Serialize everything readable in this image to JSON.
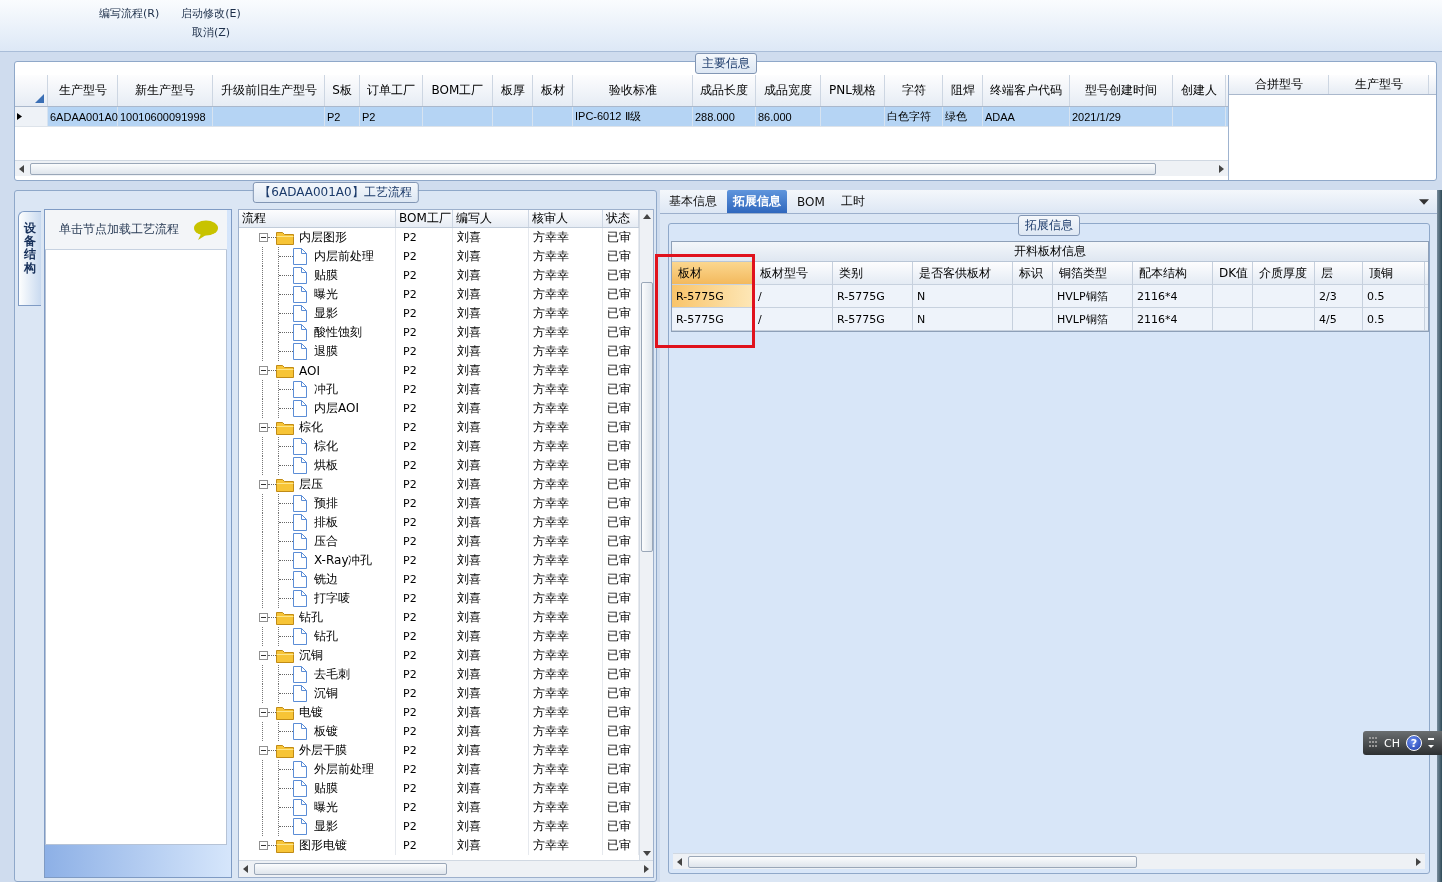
{
  "toolbar": {
    "items": [
      {
        "lines": [
          "编写流程(R)"
        ]
      },
      {
        "lines": [
          "启动修改(E)",
          "取消(Z)"
        ]
      }
    ]
  },
  "main_info": {
    "title": "主要信息",
    "table": {
      "columns": [
        "生产型号",
        "新生产型号",
        "升级前旧生产型号",
        "S板",
        "订单工厂",
        "BOM工厂",
        "板厚",
        "板材",
        "验收标准",
        "成品长度",
        "成品宽度",
        "PNL规格",
        "字符",
        "阻焊",
        "终端客户代码",
        "型号创建时间",
        "创建人"
      ],
      "rows": [
        {
          "selected": true,
          "cells": [
            "6ADAA001A0",
            "10010600091998",
            "",
            "P2",
            "P2",
            "",
            "",
            "",
            "IPC-6012 Ⅱ级",
            "288.000",
            "86.000",
            "",
            "白色字符",
            "绿色",
            "ADAA",
            "2021/1/29",
            ""
          ]
        }
      ]
    },
    "side_table": {
      "columns": [
        "合拼型号",
        "生产型号"
      ]
    }
  },
  "process": {
    "title": "【6ADAA001A0】工艺流程",
    "side_tab": "设备结构",
    "node_hint": "单击节点加载工艺流程",
    "tree": {
      "columns": [
        "流程",
        "BOM工厂",
        "编写人",
        "核审人",
        "状态"
      ],
      "rows": [
        {
          "name": "内层图形",
          "bom": "P2",
          "writer": "刘喜",
          "reviewer": "方幸幸",
          "status": "已审",
          "expanded": true,
          "children": [
            {
              "name": "内层前处理",
              "bom": "P2",
              "writer": "刘喜",
              "reviewer": "方幸幸",
              "status": "已审"
            },
            {
              "name": "贴膜",
              "bom": "P2",
              "writer": "刘喜",
              "reviewer": "方幸幸",
              "status": "已审"
            },
            {
              "name": "曝光",
              "bom": "P2",
              "writer": "刘喜",
              "reviewer": "方幸幸",
              "status": "已审"
            },
            {
              "name": "显影",
              "bom": "P2",
              "writer": "刘喜",
              "reviewer": "方幸幸",
              "status": "已审"
            },
            {
              "name": "酸性蚀刻",
              "bom": "P2",
              "writer": "刘喜",
              "reviewer": "方幸幸",
              "status": "已审"
            },
            {
              "name": "退膜",
              "bom": "P2",
              "writer": "刘喜",
              "reviewer": "方幸幸",
              "status": "已审"
            }
          ]
        },
        {
          "name": "AOI",
          "bom": "P2",
          "writer": "刘喜",
          "reviewer": "方幸幸",
          "status": "已审",
          "expanded": true,
          "children": [
            {
              "name": "冲孔",
              "bom": "P2",
              "writer": "刘喜",
              "reviewer": "方幸幸",
              "status": "已审"
            },
            {
              "name": "内层AOI",
              "bom": "P2",
              "writer": "刘喜",
              "reviewer": "方幸幸",
              "status": "已审"
            }
          ]
        },
        {
          "name": "棕化",
          "bom": "P2",
          "writer": "刘喜",
          "reviewer": "方幸幸",
          "status": "已审",
          "expanded": true,
          "children": [
            {
              "name": "棕化",
              "bom": "P2",
              "writer": "刘喜",
              "reviewer": "方幸幸",
              "status": "已审"
            },
            {
              "name": "烘板",
              "bom": "P2",
              "writer": "刘喜",
              "reviewer": "方幸幸",
              "status": "已审"
            }
          ]
        },
        {
          "name": "层压",
          "bom": "P2",
          "writer": "刘喜",
          "reviewer": "方幸幸",
          "status": "已审",
          "expanded": true,
          "children": [
            {
              "name": "预排",
              "bom": "P2",
              "writer": "刘喜",
              "reviewer": "方幸幸",
              "status": "已审"
            },
            {
              "name": "排板",
              "bom": "P2",
              "writer": "刘喜",
              "reviewer": "方幸幸",
              "status": "已审"
            },
            {
              "name": "压合",
              "bom": "P2",
              "writer": "刘喜",
              "reviewer": "方幸幸",
              "status": "已审"
            },
            {
              "name": "X-Ray冲孔",
              "bom": "P2",
              "writer": "刘喜",
              "reviewer": "方幸幸",
              "status": "已审"
            },
            {
              "name": "铣边",
              "bom": "P2",
              "writer": "刘喜",
              "reviewer": "方幸幸",
              "status": "已审"
            },
            {
              "name": "打字唛",
              "bom": "P2",
              "writer": "刘喜",
              "reviewer": "方幸幸",
              "status": "已审"
            }
          ]
        },
        {
          "name": "钻孔",
          "bom": "P2",
          "writer": "刘喜",
          "reviewer": "方幸幸",
          "status": "已审",
          "expanded": true,
          "children": [
            {
              "name": "钻孔",
              "bom": "P2",
              "writer": "刘喜",
              "reviewer": "方幸幸",
              "status": "已审"
            }
          ]
        },
        {
          "name": "沉铜",
          "bom": "P2",
          "writer": "刘喜",
          "reviewer": "方幸幸",
          "status": "已审",
          "expanded": true,
          "children": [
            {
              "name": "去毛刺",
              "bom": "P2",
              "writer": "刘喜",
              "reviewer": "方幸幸",
              "status": "已审"
            },
            {
              "name": "沉铜",
              "bom": "P2",
              "writer": "刘喜",
              "reviewer": "方幸幸",
              "status": "已审"
            }
          ]
        },
        {
          "name": "电镀",
          "bom": "P2",
          "writer": "刘喜",
          "reviewer": "方幸幸",
          "status": "已审",
          "expanded": true,
          "children": [
            {
              "name": "板镀",
              "bom": "P2",
              "writer": "刘喜",
              "reviewer": "方幸幸",
              "status": "已审"
            }
          ]
        },
        {
          "name": "外层干膜",
          "bom": "P2",
          "writer": "刘喜",
          "reviewer": "方幸幸",
          "status": "已审",
          "expanded": true,
          "children": [
            {
              "name": "外层前处理",
              "bom": "P2",
              "writer": "刘喜",
              "reviewer": "方幸幸",
              "status": "已审"
            },
            {
              "name": "贴膜",
              "bom": "P2",
              "writer": "刘喜",
              "reviewer": "方幸幸",
              "status": "已审"
            },
            {
              "name": "曝光",
              "bom": "P2",
              "writer": "刘喜",
              "reviewer": "方幸幸",
              "status": "已审"
            },
            {
              "name": "显影",
              "bom": "P2",
              "writer": "刘喜",
              "reviewer": "方幸幸",
              "status": "已审"
            }
          ]
        },
        {
          "name": "图形电镀",
          "bom": "P2",
          "writer": "刘喜",
          "reviewer": "方幸幸",
          "status": "已审",
          "expanded": true
        }
      ]
    }
  },
  "detail": {
    "tabs": [
      {
        "label": "基本信息",
        "selected": false
      },
      {
        "label": "拓展信息",
        "selected": true
      },
      {
        "label": "BOM",
        "selected": false
      },
      {
        "label": "工时",
        "selected": false
      }
    ],
    "group_title": "拓展信息",
    "highlight_frame": true,
    "table": {
      "caption": "开料板材信息",
      "columns": [
        {
          "label": "板材",
          "selected": true
        },
        {
          "label": "板材型号",
          "selected": false
        },
        {
          "label": "类别",
          "selected": false
        },
        {
          "label": "是否客供板材",
          "selected": false
        },
        {
          "label": "标识",
          "selected": false
        },
        {
          "label": "铜箔类型",
          "selected": false
        },
        {
          "label": "配本结构",
          "selected": false
        },
        {
          "label": "DK值",
          "selected": false
        },
        {
          "label": "介质厚度",
          "selected": false
        },
        {
          "label": "层",
          "selected": false
        },
        {
          "label": "顶铜",
          "selected": false
        }
      ],
      "rows": [
        {
          "focused": true,
          "cells": [
            "R-5775G",
            "/",
            "R-5775G",
            "N",
            "",
            "HVLP铜箔",
            "2116*4",
            "",
            "",
            "2/3",
            "0.5"
          ]
        },
        {
          "focused": false,
          "cells": [
            "R-5775G",
            "/",
            "R-5775G",
            "N",
            "",
            "HVLP铜箔",
            "2116*4",
            "",
            "",
            "4/5",
            "0.5"
          ]
        }
      ]
    }
  },
  "language_bar": {
    "label": "CH",
    "help": "?"
  }
}
